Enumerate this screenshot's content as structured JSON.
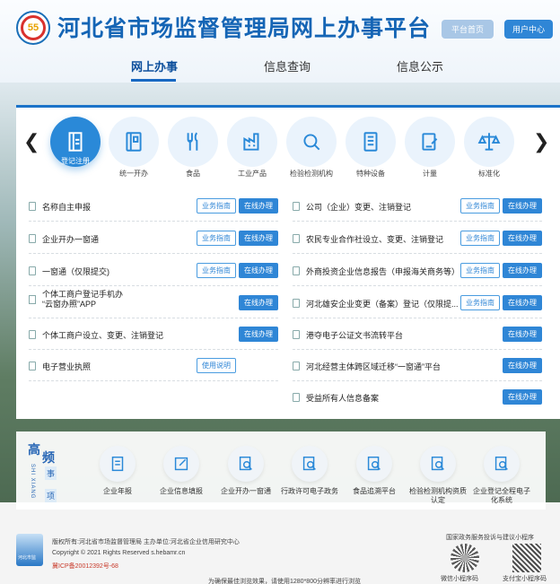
{
  "header": {
    "logo_text": "55",
    "title": "河北省市场监督管理局网上办事平台",
    "home_button": "平台首页",
    "user_button": "用户中心"
  },
  "nav": [
    "网上办事",
    "信息查询",
    "信息公示"
  ],
  "categories": [
    {
      "label": "登记注册",
      "icon": "register-icon"
    },
    {
      "label": "统一开办",
      "icon": "book-icon"
    },
    {
      "label": "食品",
      "icon": "food-icon"
    },
    {
      "label": "工业产品",
      "icon": "factory-icon"
    },
    {
      "label": "检验检测机构",
      "icon": "inspection-icon"
    },
    {
      "label": "特种设备",
      "icon": "equipment-icon"
    },
    {
      "label": "计量",
      "icon": "measure-icon"
    },
    {
      "label": "标准化",
      "icon": "scale-icon"
    }
  ],
  "buttons": {
    "guide": "业务指南",
    "online": "在线办理",
    "usage": "使用说明"
  },
  "services_left": [
    {
      "name": "名称自主申报"
    },
    {
      "name": "企业开办一窗通"
    },
    {
      "name": "一窗通（仅限提交)"
    },
    {
      "name": "个体工商户登记手机办",
      "name2": "“云窗办照”APP"
    },
    {
      "name": "个体工商户设立、变更、注销登记"
    },
    {
      "name": "电子营业执照"
    }
  ],
  "services_right": [
    {
      "name": "公司（企业）变更、注销登记"
    },
    {
      "name": "农民专业合作社设立、变更、注销登记"
    },
    {
      "name": "外商投资企业信息报告（申报海关商务等）"
    },
    {
      "name": "河北雄安企业变更（备案）登记（仅限提..."
    },
    {
      "name": "港夺电子公证文书流转平台"
    },
    {
      "name": "河北经营主体跨区域迁移“一窗通”平台"
    },
    {
      "name": "受益所有人信息备案"
    }
  ],
  "frequent": {
    "title_1": "高",
    "title_2": "频",
    "title_3": "事",
    "title_4": "项",
    "pinyin": "SHI XIANG",
    "items": [
      {
        "label": "企业年报",
        "icon": "report-icon"
      },
      {
        "label": "企业信息填报",
        "icon": "edit-icon"
      },
      {
        "label": "企业开办一窗通",
        "icon": "search-doc-icon"
      },
      {
        "label": "行政许可电子政务",
        "icon": "search-doc-icon"
      },
      {
        "label": "食品追溯平台",
        "icon": "search-doc-icon"
      },
      {
        "label": "检验检测机构资质",
        "label2": "认定",
        "icon": "search-doc-icon"
      },
      {
        "label": "企业登记全程电子",
        "label2": "化系统",
        "icon": "search-doc-icon"
      }
    ]
  },
  "footer": {
    "logo_text": "河北市监",
    "line1": "版权所有:河北省市场监督管理局 主办单位:河北省企业信用研究中心",
    "line2": "Copyright © 2021 Rights Reserved s.hebamr.cn",
    "line3": "冀ICP备20012392号-68",
    "line4": "为确保最佳浏览效果，请使用1280*800分辨率进行浏览",
    "qr_title": "国家政务服务投诉与建议小程序",
    "qr1_label": "微信小程序码",
    "qr2_label": "支付宝小程序码"
  }
}
